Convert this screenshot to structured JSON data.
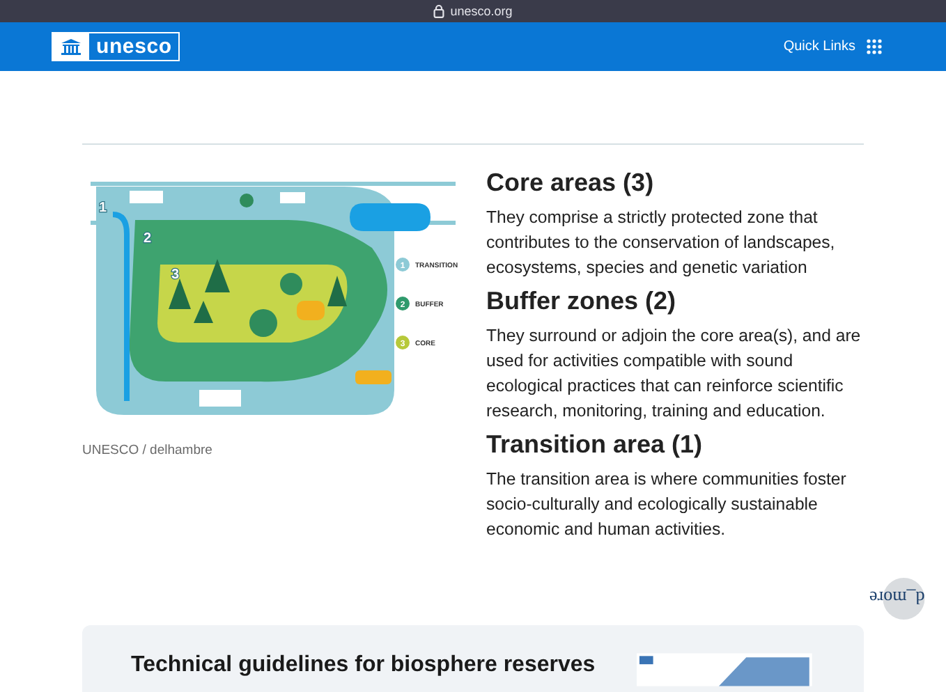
{
  "browser": {
    "url": "unesco.org"
  },
  "header": {
    "logo": "unesco",
    "quick_links": "Quick Links"
  },
  "figure": {
    "zone_numbers": [
      "1",
      "2",
      "3"
    ],
    "legend": [
      {
        "number": "1",
        "label": "TRANSITION",
        "color": "#8dcad6"
      },
      {
        "number": "2",
        "label": "BUFFER",
        "color": "#2f9a6c"
      },
      {
        "number": "3",
        "label": "CORE",
        "color": "#b7c93a"
      }
    ],
    "caption": "UNESCO / delhambre"
  },
  "zones": [
    {
      "title": "Core areas (3)",
      "text": "They comprise a strictly protected zone that contributes to the conservation of landscapes, ecosystems, species and genetic variation"
    },
    {
      "title": "Buffer zones (2)",
      "text": "They surround or adjoin the core area(s), and are used for activities compatible with sound ecological practices that can reinforce scientific research, monitoring, training and education."
    },
    {
      "title": "Transition area (1)",
      "text": "The transition area is where communities foster socio-culturally and ecologically sustainable economic and human activities."
    }
  ],
  "floating_button": {
    "label": "d_more"
  },
  "card": {
    "title": "Technical guidelines for biosphere reserves"
  }
}
